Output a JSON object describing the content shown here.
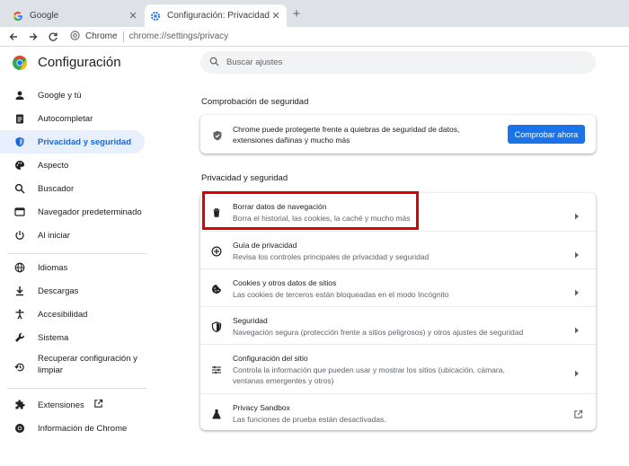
{
  "tabs": [
    {
      "title": "Google",
      "active": false,
      "favicon": "google-g-icon"
    },
    {
      "title": "Configuración: Privacidad y segur",
      "active": true,
      "favicon": "settings-gear-icon"
    }
  ],
  "toolbar": {
    "site_label": "Chrome",
    "url": "chrome://settings/privacy"
  },
  "app": {
    "title": "Configuración"
  },
  "search": {
    "placeholder": "Buscar ajustes"
  },
  "sidebar": {
    "items": [
      {
        "label": "Google y tú",
        "icon": "person-icon"
      },
      {
        "label": "Autocompletar",
        "icon": "clipboard-icon"
      },
      {
        "label": "Privacidad y seguridad",
        "icon": "shield-icon",
        "selected": true
      },
      {
        "label": "Aspecto",
        "icon": "palette-icon"
      },
      {
        "label": "Buscador",
        "icon": "search-icon"
      },
      {
        "label": "Navegador predeterminado",
        "icon": "browser-icon"
      },
      {
        "label": "Al iniciar",
        "icon": "power-icon"
      },
      {
        "label": "Idiomas",
        "icon": "globe-icon"
      },
      {
        "label": "Descargas",
        "icon": "download-icon"
      },
      {
        "label": "Accesibilidad",
        "icon": "accessibility-icon"
      },
      {
        "label": "Sistema",
        "icon": "wrench-icon"
      },
      {
        "label": "Recuperar configuración y",
        "label2": "limpiar",
        "icon": "restore-icon"
      },
      {
        "label": "Extensiones",
        "icon": "puzzle-icon"
      },
      {
        "label": "Información de Chrome",
        "icon": "chrome-icon"
      }
    ]
  },
  "safety_check": {
    "section_title": "Comprobación de seguridad",
    "description": "Chrome puede protegerte frente a quiebras de seguridad de datos, extensiones dañinas y mucho más",
    "button": "Comprobar ahora"
  },
  "privacy": {
    "section_title": "Privacidad y seguridad",
    "rows": [
      {
        "title": "Borrar datos de navegación",
        "subtitle": "Borra el historial, las cookies, la caché y mucho más",
        "icon": "trash-icon"
      },
      {
        "title": "Guía de privacidad",
        "subtitle": "Revisa los controles principales de privacidad y seguridad",
        "icon": "compass-icon"
      },
      {
        "title": "Cookies y otros datos de sitios",
        "subtitle": "Las cookies de terceros están bloqueadas en el modo Incógnito",
        "icon": "cookie-icon"
      },
      {
        "title": "Seguridad",
        "subtitle": "Navegación segura (protección frente a sitios peligrosos) y otros ajustes de seguridad",
        "icon": "shield-icon"
      },
      {
        "title": "Configuración del sitio",
        "subtitle": "Controla la información que pueden usar y mostrar los sitios (ubicación, cámara, ventanas emergentes y otros)",
        "icon": "sliders-icon"
      },
      {
        "title": "Privacy Sandbox",
        "subtitle": "Las funciones de prueba están desactivadas.",
        "icon": "flask-icon"
      }
    ]
  },
  "colors": {
    "accent": "#1a73e8",
    "selected_bg": "#e8f0fe",
    "highlight": "#e00000"
  }
}
